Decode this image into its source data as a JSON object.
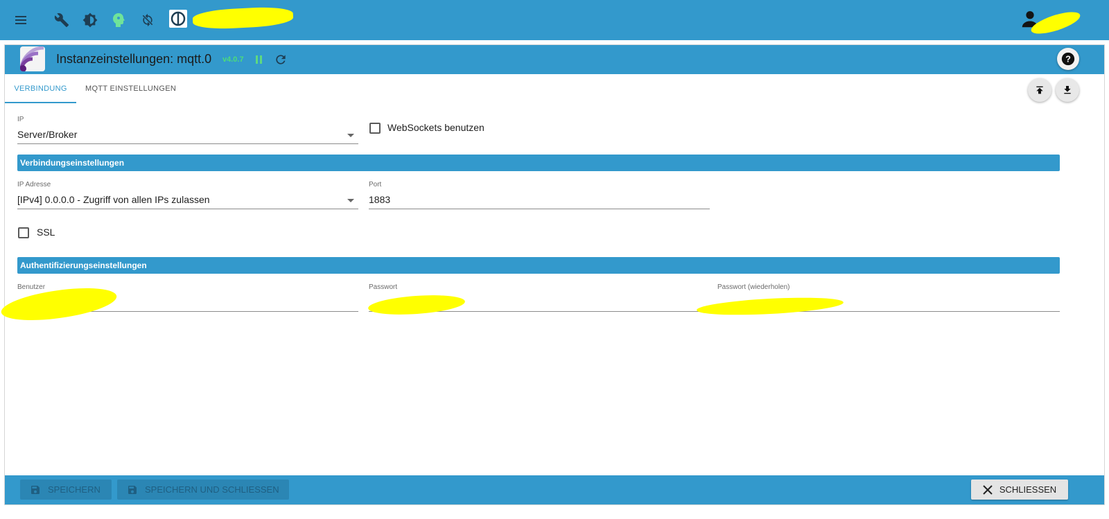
{
  "colors": {
    "primary": "#3399cc",
    "version_green": "#4cdc7a",
    "redaction": "#ffff00"
  },
  "topbar": {
    "icons": [
      "menu-icon",
      "wrench-icon",
      "brightness-icon",
      "head-icon",
      "sync-icon",
      "iobroker-logo-icon",
      "user-icon"
    ]
  },
  "header": {
    "title": "Instanzeinstellungen: mqtt.0",
    "version": "v4.0.7",
    "icons": [
      "mqtt-adapter-icon",
      "pause-icon",
      "reload-icon",
      "help-icon"
    ]
  },
  "tabs": [
    {
      "label": "VERBINDUNG",
      "active": true
    },
    {
      "label": "MQTT EINSTELLUNGEN",
      "active": false
    }
  ],
  "actions": {
    "icons": [
      "upload-icon",
      "download-icon"
    ]
  },
  "form": {
    "ip_label": "IP",
    "ip_value": "Server/Broker",
    "websockets_label": "WebSockets benutzen",
    "websockets_checked": false,
    "section_connection": "Verbindungseinstellungen",
    "ip_address_label": "IP Adresse",
    "ip_address_value": "[IPv4] 0.0.0.0 - Zugriff von allen IPs zulassen",
    "port_label": "Port",
    "port_value": "1883",
    "ssl_label": "SSL",
    "ssl_checked": false,
    "section_auth": "Authentifizierungseinstellungen",
    "user_label": "Benutzer",
    "password_label": "Passwort",
    "password_repeat_label": "Passwort (wiederholen)"
  },
  "footer": {
    "save_label": "SPEICHERN",
    "save_close_label": "SPEICHERN UND SCHLIESSEN",
    "close_label": "SCHLIESSEN"
  }
}
